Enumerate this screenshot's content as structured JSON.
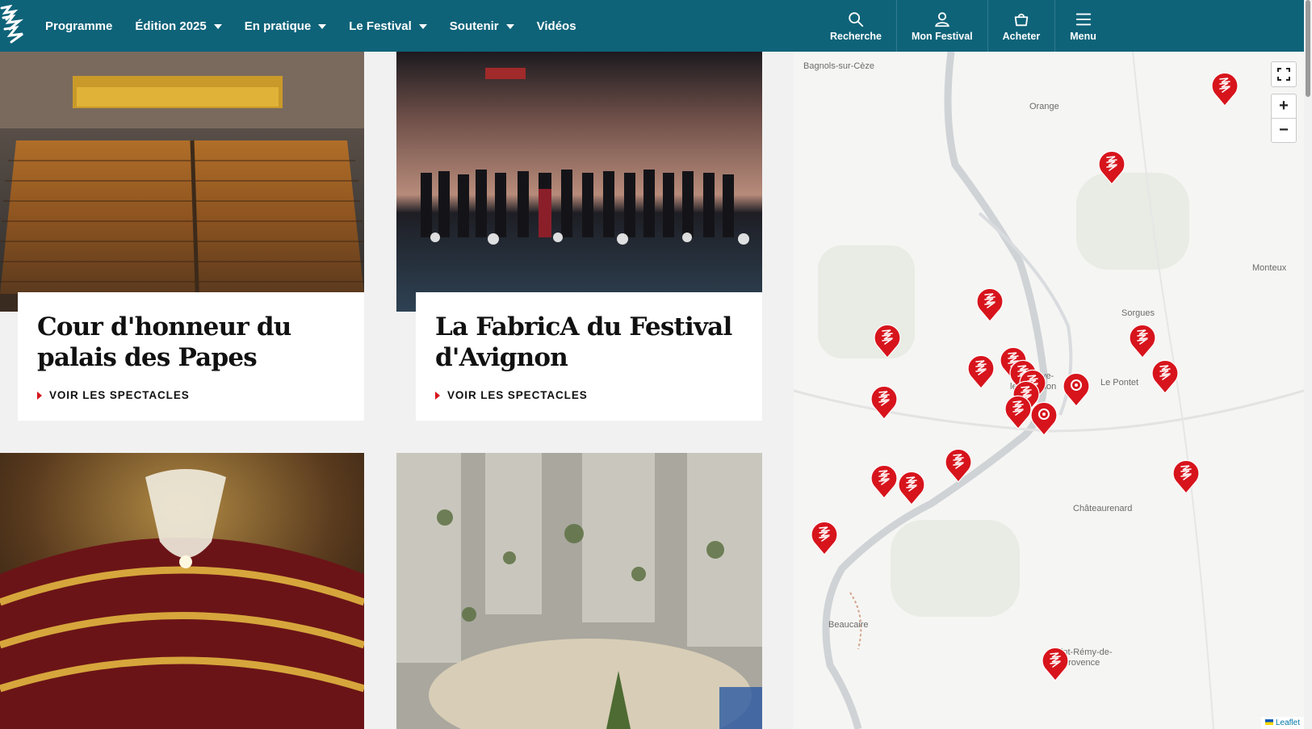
{
  "nav": {
    "items": [
      {
        "label": "Programme",
        "dropdown": false
      },
      {
        "label": "Édition 2025",
        "dropdown": true
      },
      {
        "label": "En pratique",
        "dropdown": true
      },
      {
        "label": "Le Festival",
        "dropdown": true
      },
      {
        "label": "Soutenir",
        "dropdown": true
      },
      {
        "label": "Vidéos",
        "dropdown": false
      }
    ],
    "tools": [
      {
        "label": "Recherche",
        "icon": "search-icon"
      },
      {
        "label": "Mon Festival",
        "icon": "user-icon"
      },
      {
        "label": "Acheter",
        "icon": "basket-icon"
      },
      {
        "label": "Menu",
        "icon": "hamburger-icon"
      }
    ]
  },
  "cards": [
    {
      "title": "Cour d'honneur du palais des Papes",
      "link": "VOIR LES SPECTACLES"
    },
    {
      "title": "La FabricA du Festival d'Avignon",
      "link": "VOIR LES SPECTACLES"
    }
  ],
  "map": {
    "labels": [
      "Bagnols-sur-Cèze",
      "Orange",
      "Monteux",
      "Sorgues",
      "Le Pontet",
      "Châteaurenard",
      "Beaucaire",
      "Saint-Rémy-de-Provence",
      "Villeneuve-lès-Avignon"
    ],
    "zoom_in": "+",
    "zoom_out": "−",
    "attribution": "Leaflet"
  },
  "colors": {
    "header": "#0e6379",
    "accent": "#d7141c",
    "card_bg": "#ffffff"
  }
}
